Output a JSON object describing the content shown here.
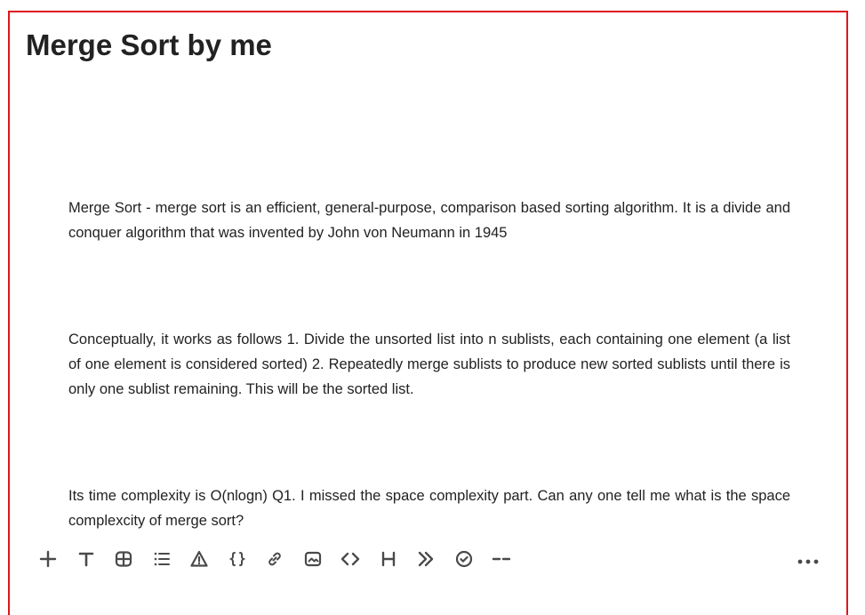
{
  "page": {
    "title": "Merge Sort by me",
    "frame_color": "#e0161b"
  },
  "content": {
    "paragraphs": [
      "Merge Sort - merge sort is an efficient, general-purpose, comparison based sorting algorithm. It is a divide and conquer algorithm that was invented by John von Neumann in 1945",
      "Conceptually, it works as follows 1. Divide the unsorted list into n sublists, each containing one element (a list of one element is considered sorted) 2. Repeatedly merge sublists to produce new sorted sublists until there is only one sublist remaining. This will be the sorted list.",
      "Its time complexity is O(nlogn) Q1. I missed the space complexity part. Can any one tell me what is the space complexcity of merge sort?"
    ]
  },
  "toolbar": {
    "icon_color": "#4a4a4a",
    "tools": [
      {
        "name": "plus-icon"
      },
      {
        "name": "text-icon"
      },
      {
        "name": "table-icon"
      },
      {
        "name": "list-icon"
      },
      {
        "name": "warning-icon"
      },
      {
        "name": "braces-icon"
      },
      {
        "name": "link-icon"
      },
      {
        "name": "image-icon"
      },
      {
        "name": "code-icon"
      },
      {
        "name": "heading-icon"
      },
      {
        "name": "quote-icon"
      },
      {
        "name": "check-circle-icon"
      },
      {
        "name": "divider-icon"
      }
    ],
    "more": {
      "name": "more-horizontal-icon"
    }
  }
}
